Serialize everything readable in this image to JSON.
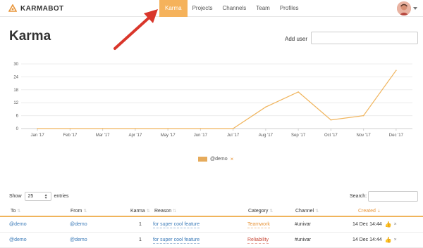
{
  "brand": {
    "name": "KARMABOT",
    "icon": "karmabot-logo-icon"
  },
  "nav": {
    "items": [
      {
        "label": "Karma",
        "active": true
      },
      {
        "label": "Projects",
        "active": false
      },
      {
        "label": "Channels",
        "active": false
      },
      {
        "label": "Team",
        "active": false
      },
      {
        "label": "Profiles",
        "active": false
      }
    ]
  },
  "header": {
    "title": "Karma",
    "add_user_label": "Add user",
    "add_user_value": ""
  },
  "chart_data": {
    "type": "line",
    "categories": [
      "Jan '17",
      "Feb '17",
      "Mar '17",
      "Apr '17",
      "May '17",
      "Jun '17",
      "Jul '17",
      "Aug '17",
      "Sep '17",
      "Oct '17",
      "Nov '17",
      "Dec '17"
    ],
    "series": [
      {
        "name": "@demo",
        "values": [
          0,
          0,
          0,
          0,
          0,
          0,
          0,
          10,
          17,
          4,
          6,
          27
        ],
        "color": "#f0b45c"
      }
    ],
    "y_ticks": [
      0,
      6,
      12,
      18,
      24,
      30
    ],
    "ylim": [
      0,
      30
    ],
    "grid": true,
    "legend_position": "bottom-center"
  },
  "legend": {
    "label": "@demo",
    "remove": "×"
  },
  "table_controls": {
    "show_label": "Show",
    "page_size": "25",
    "entries_label": "entries",
    "search_label": "Search:",
    "search_value": ""
  },
  "table": {
    "columns": [
      "To",
      "From",
      "Karma",
      "Reason",
      "Category",
      "Channel",
      "Created"
    ],
    "rows": [
      {
        "to": "@demo",
        "from": "@demo",
        "karma": "1",
        "reason": "for super cool feature",
        "category": "Teamwork",
        "channel": "#univar",
        "created": "14 Dec 14:44"
      },
      {
        "to": "@demo",
        "from": "@demo",
        "karma": "1",
        "reason": "for super cool feature",
        "category": "Reliability",
        "channel": "#univar",
        "created": "14 Dec 14:44"
      }
    ]
  },
  "colors": {
    "accent": "#f5b25b",
    "series_line": "#f0b45c",
    "link": "#3a7ab8",
    "annotation_arrow": "#d9362b"
  }
}
